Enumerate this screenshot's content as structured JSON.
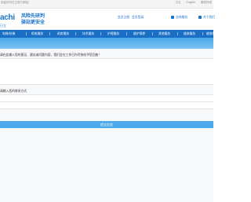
{
  "topbar": {
    "welcome": "欢迎访问日立官方网站！",
    "link_home": "中文",
    "link_english": "English",
    "link_site": "服务热线"
  },
  "header": {
    "logo_text": "achi",
    "logo_sub": "日立",
    "slogan_line1": "风险先研判",
    "slogan_line2": "驿站更安全",
    "btn_login": "会员注册",
    "btn_member": "会员登录",
    "btn_service": "咨询服务",
    "btn_account": "关于我们"
  },
  "nav": {
    "items": [
      "电梯/扶梯",
      "机电服务",
      "机房服务",
      "技术服务",
      "护理服务",
      "维护保养",
      "其他服务",
      "维修服务",
      "维修服务"
    ]
  },
  "form": {
    "notice": "请在此输入您的意见、建议或问题内容，我们会在工作日内尽快给予您回复！",
    "second_label": "请输入您的联系方式",
    "submit_label": "提交信息"
  }
}
